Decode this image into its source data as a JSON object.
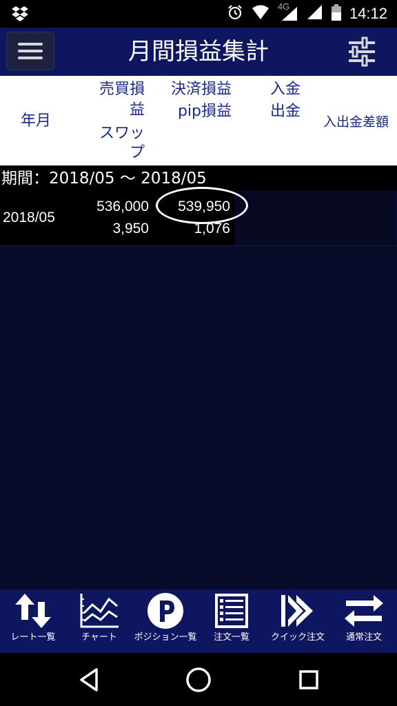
{
  "status_bar": {
    "time": "14:12",
    "network": "4G",
    "icons": [
      "dropbox-icon",
      "alarm-icon",
      "wifi-icon",
      "signal-icon",
      "battery-icon"
    ]
  },
  "app_bar": {
    "title": "月間損益集計",
    "menu_icon": "hamburger-menu-icon",
    "settings_icon": "filter-sliders-icon"
  },
  "table_header": {
    "year_month": "年月",
    "trade_profit_line1": "売買損",
    "trade_profit_line2": "益",
    "swap_line1": "スワッ",
    "swap_line2": "プ",
    "settlement_profit": "決済損益",
    "pip_profit": "pip損益",
    "deposit": "入金",
    "withdrawal": "出金",
    "deposit_withdrawal_diff": "入出金差額"
  },
  "period": {
    "label": "期間：2018/05 〜 2018/05"
  },
  "rows": [
    {
      "year_month": "2018/05",
      "trade_profit": "536,000",
      "swap": "3,950",
      "settlement_profit": "539,950",
      "pip_profit": "1,076"
    }
  ],
  "bottom_nav": [
    {
      "label": "レート一覧",
      "icon": "rate-list-arrows-icon"
    },
    {
      "label": "チャート",
      "icon": "chart-icon"
    },
    {
      "label": "ポジション一覧",
      "icon": "position-p-icon"
    },
    {
      "label": "注文一覧",
      "icon": "order-list-icon"
    },
    {
      "label": "クイック注文",
      "icon": "quick-order-icon"
    },
    {
      "label": "通常注文",
      "icon": "normal-order-icon"
    }
  ],
  "system_nav": {
    "icons": [
      "back-icon",
      "home-icon",
      "recents-icon"
    ]
  },
  "colors": {
    "app_bar": "#0e1660",
    "background": "#070b2a",
    "header_text": "#1b2a8a"
  }
}
